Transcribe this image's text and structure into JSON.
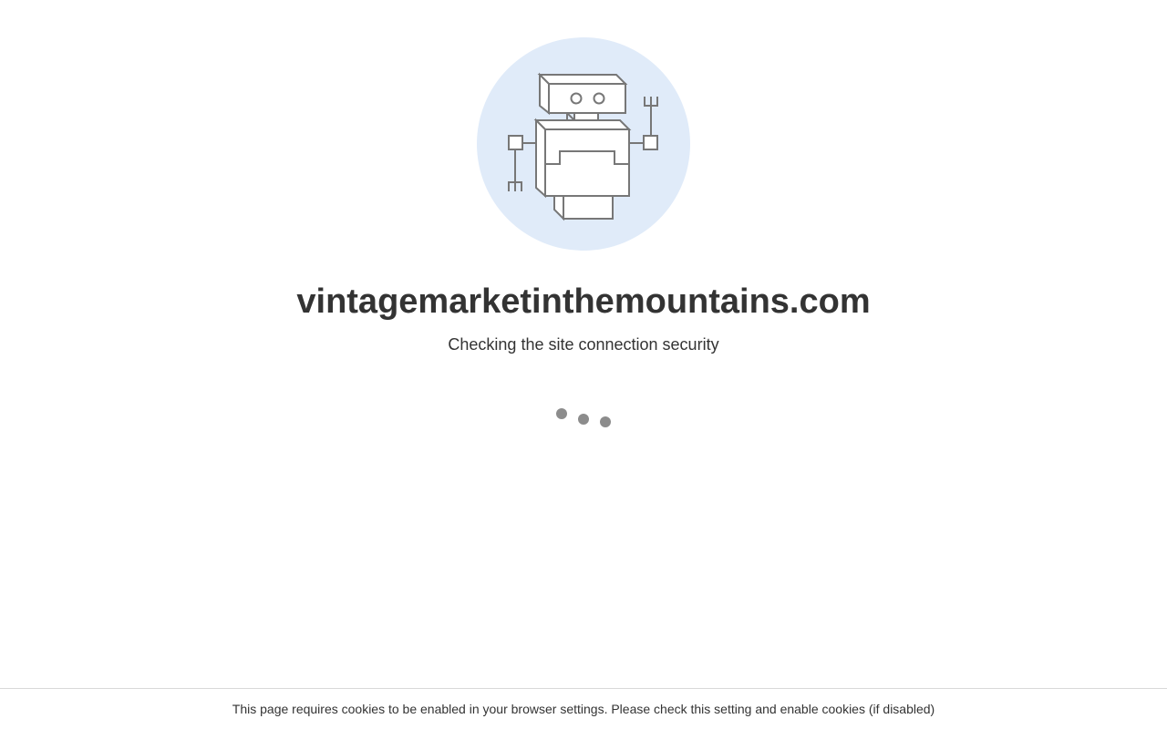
{
  "page": {
    "site_name": "vintagemarketinthemountains.com",
    "status_text": "Checking the site connection security",
    "footer_notice": "This page requires cookies to be enabled in your browser settings. Please check this setting and enable cookies (if disabled)"
  },
  "illustration": {
    "icon": "robot-icon",
    "circle_color": "#e0ebf9",
    "stroke_color": "#777777"
  },
  "loader": {
    "icon": "loading-dots",
    "dot_color": "#8c8c8c"
  }
}
